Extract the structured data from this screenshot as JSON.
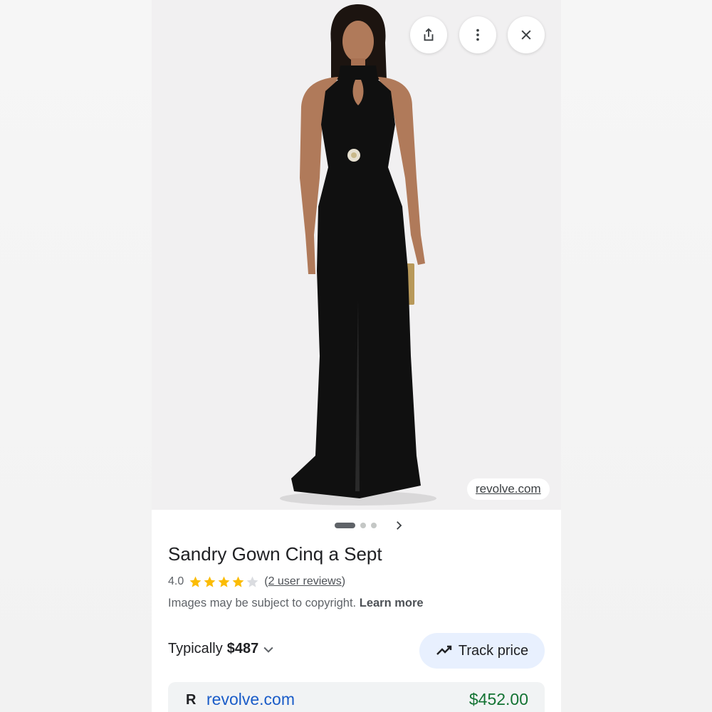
{
  "image": {
    "source_label": "revolve.com"
  },
  "actions": {
    "share_icon": "share-icon",
    "more_icon": "more-vert-icon",
    "close_icon": "close-icon"
  },
  "carousel": {
    "current_page": 1,
    "page_count": 3
  },
  "product": {
    "title": "Sandry Gown Cinq a Sept",
    "rating_value": "4.0",
    "stars_filled": 4,
    "stars_total": 5,
    "reviews_link": "2 user reviews",
    "reviews_open": "(",
    "reviews_close": ")",
    "copyright_note": "Images may be subject to copyright.",
    "learn_more": "Learn more"
  },
  "pricing": {
    "typical_label": "Typically",
    "typical_amount": "$487",
    "track_label": "Track price"
  },
  "offer": {
    "seller_icon": "R",
    "seller": "revolve.com",
    "price": "$452.00"
  },
  "colors": {
    "star": "#fbbc04",
    "star_empty": "#dadce0",
    "link_blue": "#1a5cc8",
    "price_green": "#137333",
    "track_bg": "#e8f0fe"
  }
}
